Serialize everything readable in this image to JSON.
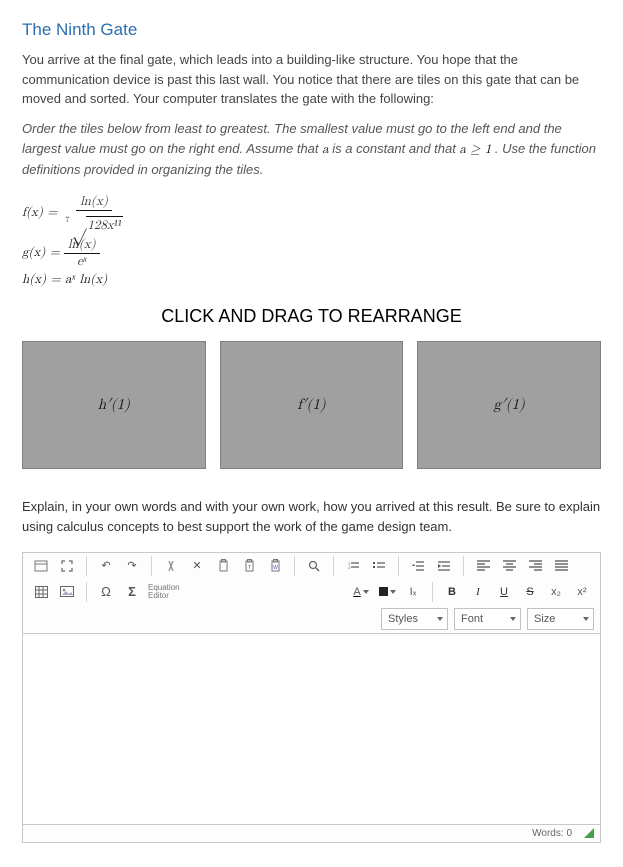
{
  "title": "The Ninth Gate",
  "intro": "You arrive at the final gate, which leads into a building-like structure. You hope that the communication device is past this last wall. You notice that there are tiles on this gate that can be moved and sorted. Your computer translates the gate with the following:",
  "instructions_pre": "Order the tiles below from least to greatest. The smallest value must go to the left end and the largest value must go on the right end. Assume that ",
  "instructions_var": "a",
  "instructions_mid": " is a constant and that ",
  "instructions_cond": "a ≥ 1",
  "instructions_post": ". Use the function definitions provided in organizing the tiles.",
  "formulas": {
    "f_lhs": "f(x) =",
    "f_num": "ln(x)",
    "f_root_index": "7",
    "f_root_radicand": "128x¹¹",
    "g_lhs": "g(x) =",
    "g_num": "ln(x)",
    "g_den": "eˣ",
    "h_full": "h(x) = aˣ ln(x)"
  },
  "drag_header": "CLICK AND DRAG TO REARRANGE",
  "tiles": [
    "h′(1)",
    "f′(1)",
    "g′(1)"
  ],
  "explain": "Explain, in your own words and with your own work, how you arrived at this result. Be sure to explain using calculus concepts to best support the work of the game design team.",
  "editor": {
    "text_color_label": "A",
    "eq_sigma": "Σ",
    "eq_label": "Equation\nEditor",
    "bold": "B",
    "italic": "I",
    "underline": "U",
    "strike": "S",
    "sub": "x₂",
    "sup": "x²",
    "clear_fmt": "Iₓ",
    "omega": "Ω",
    "combos": {
      "styles": "Styles",
      "font": "Font",
      "size": "Size"
    },
    "status": {
      "words_label": "Words:",
      "words_value": "0"
    }
  }
}
